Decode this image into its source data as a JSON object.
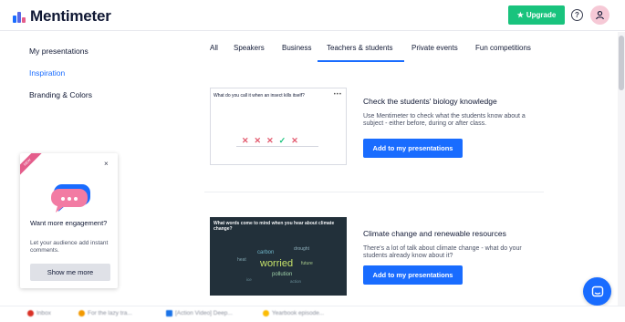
{
  "header": {
    "logo_text": "Mentimeter",
    "upgrade_label": "Upgrade",
    "help_label": "?"
  },
  "sidebar": {
    "items": [
      {
        "label": "My presentations",
        "active": false
      },
      {
        "label": "Inspiration",
        "active": true
      },
      {
        "label": "Branding & Colors",
        "active": false
      }
    ]
  },
  "tabs": [
    {
      "label": "All"
    },
    {
      "label": "Speakers"
    },
    {
      "label": "Business"
    },
    {
      "label": "Teachers & students",
      "active": true
    },
    {
      "label": "Private events"
    },
    {
      "label": "Fun competitions"
    }
  ],
  "cards": [
    {
      "thumb_question": "What do you call it when an insect kills itself?",
      "title": "Check the students' biology knowledge",
      "description": "Use Mentimeter to check what the students know about a subject - either before, during or after class.",
      "button_label": "Add to my presentations"
    },
    {
      "thumb_question": "What words come to mind when you hear about climate change?",
      "cloud_words": [
        "worried",
        "carbon",
        "pollution",
        "drought",
        "heat",
        "future",
        "ice",
        "action"
      ],
      "title": "Climate change and renewable resources",
      "description": "There's a lot of talk about climate change - what do your students already know about it?",
      "button_label": "Add to my presentations"
    }
  ],
  "promo": {
    "ribbon": "NEW",
    "close_label": "×",
    "title": "Want more engagement?",
    "description": "Let your audience add instant comments.",
    "button_label": "Show me more"
  },
  "bookmarks": [
    {
      "label": "Inbox",
      "color": "#d93025"
    },
    {
      "label": "For the lazy tra...",
      "color": "#f29900"
    },
    {
      "label": "[Action Video] Deep...",
      "color": "#1a73e8"
    },
    {
      "label": "Yearbook episode...",
      "color": "#fbbc04"
    }
  ],
  "colors": {
    "brand_blue": "#196cff",
    "upgrade_green": "#19c37d",
    "accent_pink": "#e45d8b"
  }
}
